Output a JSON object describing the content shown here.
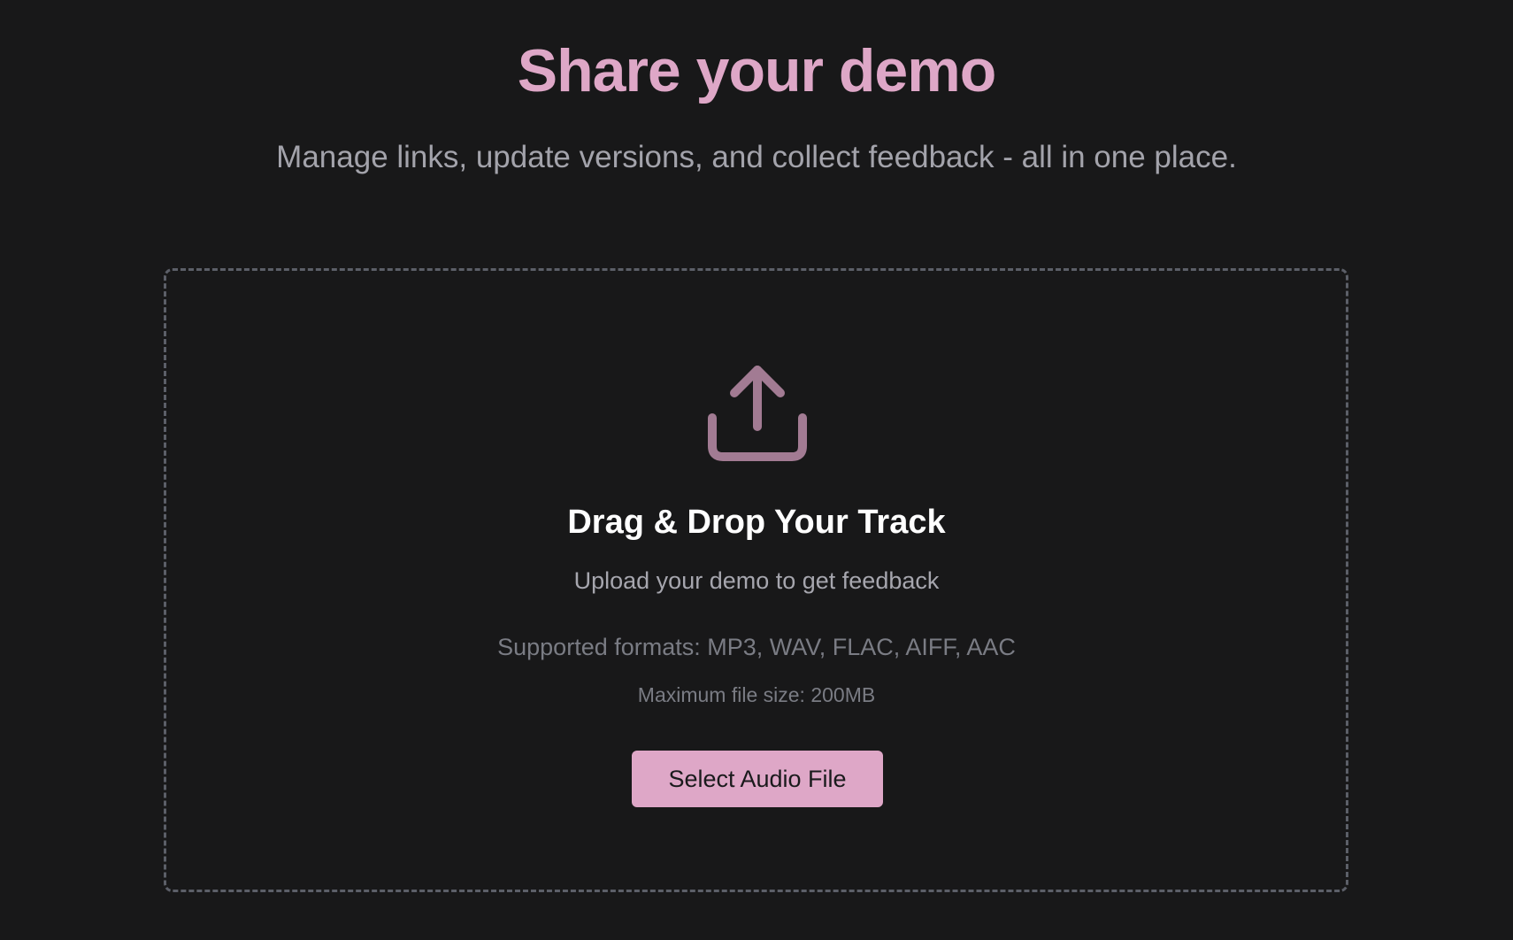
{
  "header": {
    "title": "Share your demo",
    "subtitle": "Manage links, update versions, and collect feedback - all in one place."
  },
  "dropzone": {
    "icon": "upload-icon",
    "title": "Drag & Drop Your Track",
    "subtitle": "Upload your demo to get feedback",
    "formats": "Supported formats: MP3, WAV, FLAC, AIFF, AAC",
    "max_size": "Maximum file size: 200MB",
    "button_label": "Select Audio File"
  },
  "colors": {
    "background": "#181819",
    "accent": "#dea7c7",
    "icon": "#a27b93",
    "border": "#5c5f68"
  }
}
